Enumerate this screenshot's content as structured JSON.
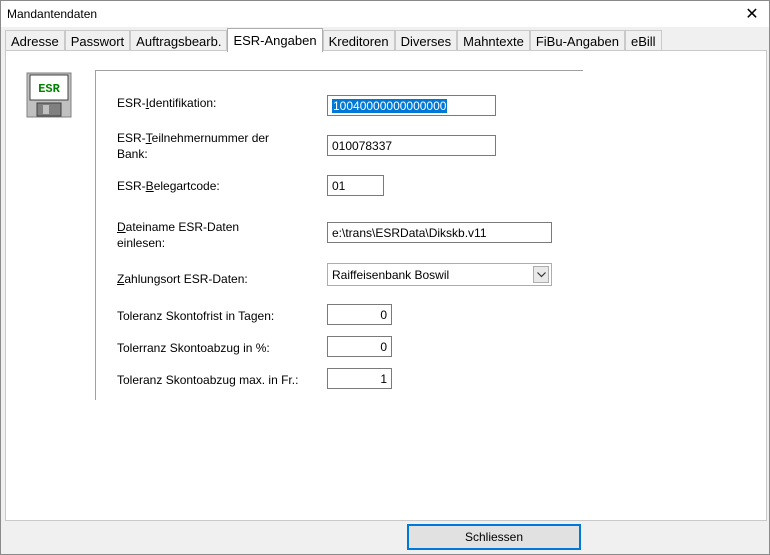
{
  "window": {
    "title": "Mandantendaten"
  },
  "tabs": [
    {
      "label": "Adresse"
    },
    {
      "label": "Passwort"
    },
    {
      "label": "Auftragsbearb."
    },
    {
      "label": "ESR-Angaben"
    },
    {
      "label": "Kreditoren"
    },
    {
      "label": "Diverses"
    },
    {
      "label": "Mahntexte"
    },
    {
      "label": "FiBu-Angaben"
    },
    {
      "label": "eBill"
    }
  ],
  "active_tab": "ESR-Angaben",
  "icon": {
    "name": "esr-disk-icon",
    "text": "ESR"
  },
  "form": {
    "esr_id": {
      "label_pre": "ESR-",
      "label_u": "I",
      "label_post": "dentifikation:",
      "value": "10040000000000000"
    },
    "teilnehmer": {
      "label_pre": "ESR-",
      "label_u": "T",
      "label_post": "eilnehmernummer der",
      "label_line2": "Bank:",
      "value": "010078337"
    },
    "belegart": {
      "label_pre": "ESR-",
      "label_u": "B",
      "label_post": "elegartcode:",
      "value": "01"
    },
    "dateiname": {
      "label_pre": "",
      "label_u": "D",
      "label_post": "ateiname ESR-Daten",
      "label_line2": "einlesen:",
      "value": "e:\\trans\\ESRData\\Dikskb.v11"
    },
    "zahlungsort": {
      "label_pre": "",
      "label_u": "Z",
      "label_post": "ahlungsort ESR-Daten:",
      "value": "Raiffeisenbank Boswil"
    },
    "skontofrist": {
      "label": "Toleranz Skontofrist in Tagen:",
      "value": "0"
    },
    "skontoabzug": {
      "label": "Tolerranz Skontoabzug in %:",
      "value": "0"
    },
    "skontomax": {
      "label": "Toleranz Skontoabzug max. in Fr.:",
      "value": "1"
    }
  },
  "buttons": {
    "close_label": "Schliessen"
  }
}
